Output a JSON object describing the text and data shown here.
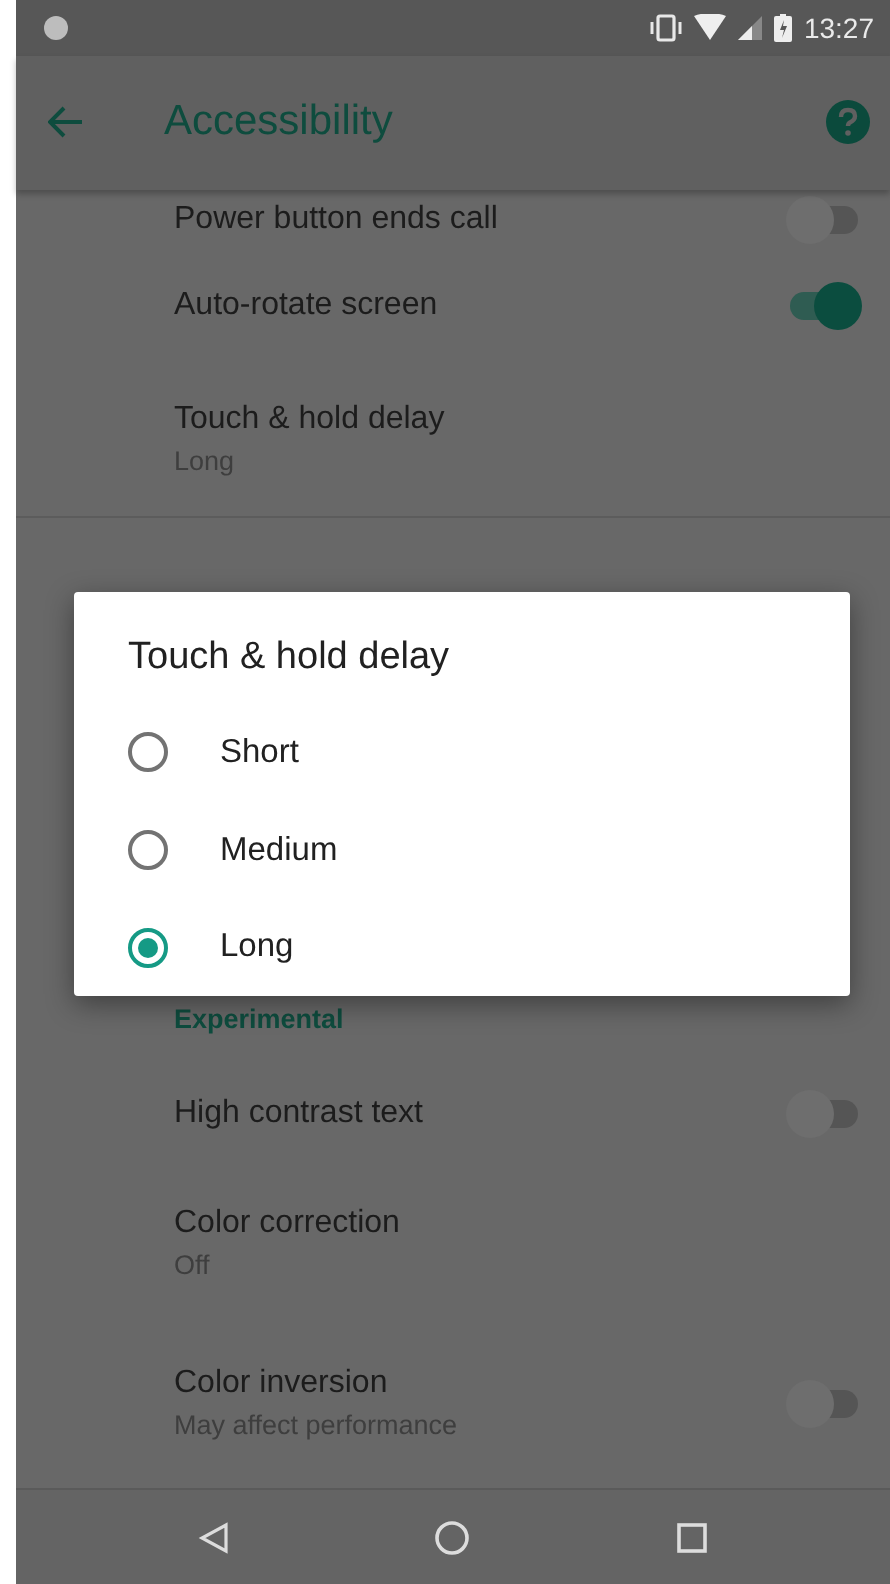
{
  "status_bar": {
    "time": "13:27"
  },
  "app_bar": {
    "title": "Accessibility"
  },
  "settings_top": [
    {
      "kind": "toggle",
      "title": "Power button ends call",
      "on": false
    },
    {
      "kind": "toggle",
      "title": "Auto-rotate screen",
      "on": true
    },
    {
      "kind": "value",
      "title": "Touch & hold delay",
      "summary": "Long"
    }
  ],
  "section_header": "Experimental",
  "settings_bottom": [
    {
      "kind": "toggle",
      "title": "High contrast text",
      "on": false
    },
    {
      "kind": "value",
      "title": "Color correction",
      "summary": "Off"
    },
    {
      "kind": "toggle",
      "title": "Color inversion",
      "summary": "May affect performance",
      "on": false
    }
  ],
  "dialog": {
    "title": "Touch & hold delay",
    "options": [
      {
        "label": "Short",
        "selected": false
      },
      {
        "label": "Medium",
        "selected": false
      },
      {
        "label": "Long",
        "selected": true
      }
    ]
  }
}
